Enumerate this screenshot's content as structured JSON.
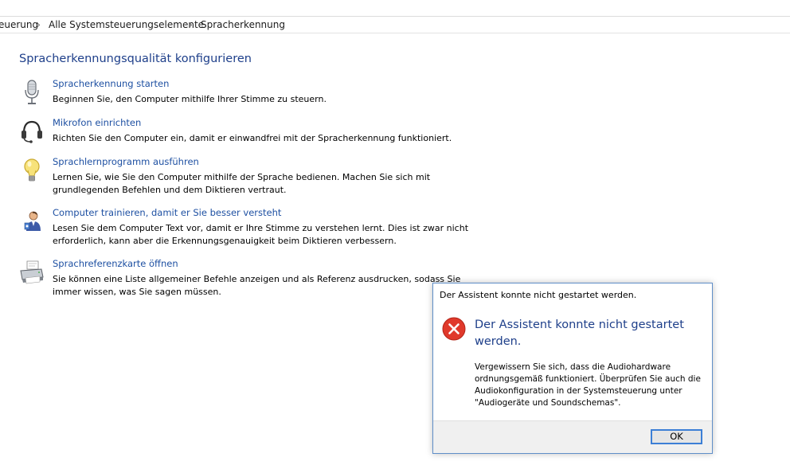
{
  "breadcrumb": {
    "items": [
      "euerung",
      "Alle Systemsteuerungselemente",
      "Spracherkennung"
    ],
    "separator": "›"
  },
  "page": {
    "title": "Spracherkennungsqualität konfigurieren"
  },
  "items": [
    {
      "icon": "microphone-icon",
      "link": "Spracherkennung starten",
      "desc": "Beginnen Sie, den Computer mithilfe Ihrer Stimme zu steuern."
    },
    {
      "icon": "headset-icon",
      "link": "Mikrofon einrichten",
      "desc": "Richten Sie den Computer ein, damit er einwandfrei mit der Spracherkennung funktioniert."
    },
    {
      "icon": "lightbulb-icon",
      "link": "Sprachlernprogramm ausführen",
      "desc": "Lernen Sie, wie Sie den Computer mithilfe der Sprache bedienen. Machen Sie sich mit grundlegenden Befehlen und dem Diktieren vertraut."
    },
    {
      "icon": "user-training-icon",
      "link": "Computer trainieren, damit er Sie besser versteht",
      "desc": "Lesen Sie dem Computer Text vor, damit er Ihre Stimme zu verstehen lernt. Dies ist zwar nicht erforderlich, kann aber die Erkennungsgenauigkeit beim Diktieren verbessern."
    },
    {
      "icon": "printer-icon",
      "link": "Sprachreferenzkarte öffnen",
      "desc": "Sie können eine Liste allgemeiner Befehle anzeigen und als Referenz ausdrucken, sodass Sie immer wissen, was Sie sagen müssen."
    }
  ],
  "dialog": {
    "title": "Der Assistent konnte nicht gestartet werden.",
    "icon": "error-icon",
    "heading": "Der Assistent konnte nicht gestartet werden.",
    "body": "Vergewissern Sie sich, dass die Audiohardware ordnungsgemäß funktioniert. Überprüfen Sie auch die Audiokonfiguration in der Systemsteuerung unter \"Audiogeräte und Soundschemas\".",
    "ok_label": "OK"
  },
  "colors": {
    "link": "#1e50a2",
    "title": "#1e3f8a",
    "error": "#e0392b",
    "focus_border": "#3c7fd6"
  }
}
